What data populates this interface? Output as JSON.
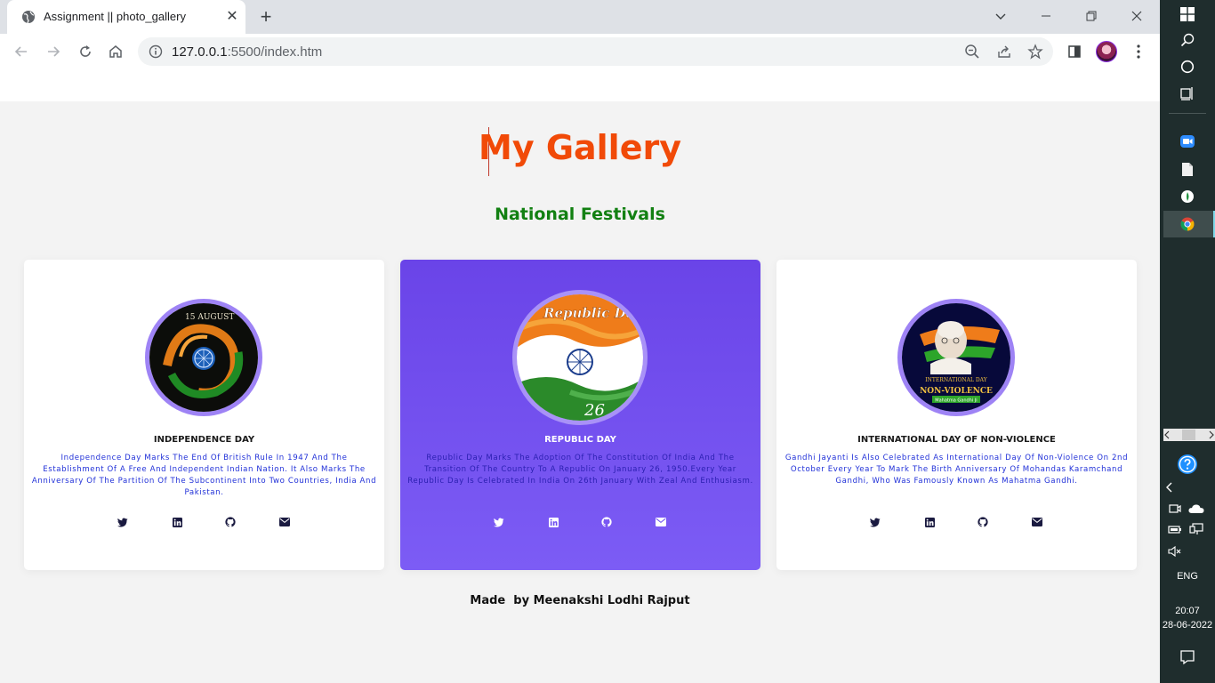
{
  "browser": {
    "tab_title": "Assignment || photo_gallery",
    "url_host": "127.0.0.1",
    "url_rest": ":5500/index.htm"
  },
  "page": {
    "title": "My Gallery",
    "subtitle": "National Festivals",
    "footer": "Made  by Meenakshi Lodhi Rajput",
    "cards": [
      {
        "name": "INDEPENDENCE DAY",
        "description": "Independence Day Marks The End Of British Rule In 1947 And The Establishment Of A Free And Independent Indian Nation. It Also Marks The Anniversary Of The Partition Of The Subcontinent Into Two Countries, India And Pakistan.",
        "image_text": "15 AUGUST"
      },
      {
        "name": "REPUBLIC DAY",
        "description": "Republic Day Marks The Adoption Of The Constitution Of India And The Transition Of The Country To A Republic On January 26, 1950.Every Year Republic Day Is Celebrated In India On 26th January With Zeal And Enthusiasm.",
        "image_text": "Republic Day",
        "image_text_2": "26"
      },
      {
        "name": "INTERNATIONAL DAY OF NON-VIOLENCE",
        "description": "Gandhi Jayanti Is Also Celebrated As International Day Of Non-Violence On 2nd October Every Year To Mark The Birth Anniversary Of Mohandas Karamchand Gandhi, Who Was Famously Known As Mahatma Gandhi.",
        "image_text": "INTERNATIONAL DAY",
        "image_text_2": "NON-VIOLENCE",
        "image_text_3": "Mahatma Gandhi Ji"
      }
    ],
    "social_icons": [
      "twitter-icon",
      "linkedin-icon",
      "github-icon",
      "envelope-icon"
    ]
  },
  "taskbar": {
    "language": "ENG",
    "time": "20:07",
    "date": "28-06-2022"
  },
  "colors": {
    "title": "#f14a08",
    "subtitle": "#128012",
    "active_card": "#6a44e8",
    "description": "#2030d8"
  }
}
